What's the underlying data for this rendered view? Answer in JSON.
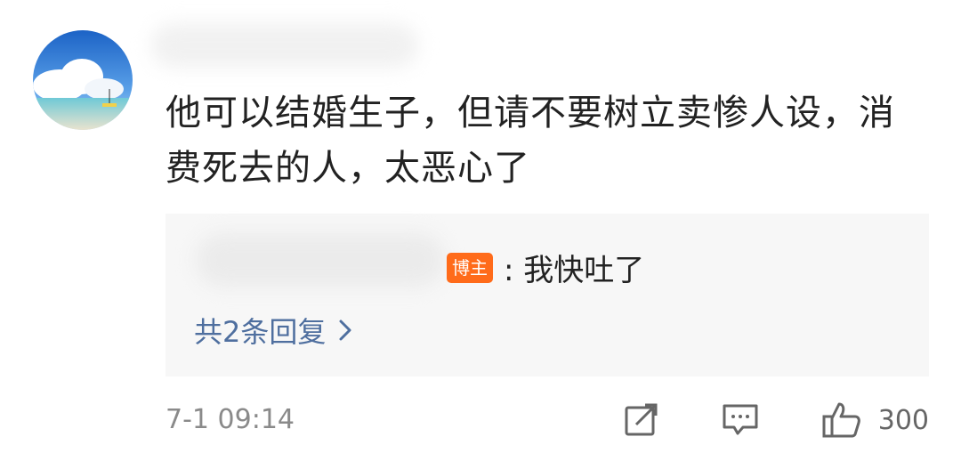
{
  "comment": {
    "text": "他可以结婚生子，但请不要树立卖惨人设，消费死去的人，太恶心了"
  },
  "reply": {
    "badge_label": "博主",
    "text": ": 我快吐了",
    "more_label": "共2条回复"
  },
  "meta": {
    "timestamp": "7-1 09:14",
    "like_count": "300"
  },
  "icons": {
    "avatar": "avatar-photo",
    "share": "share-icon",
    "reply": "comment-icon",
    "like": "thumbs-up-icon",
    "chevron": "chevron-right-icon"
  },
  "colors": {
    "badge": "#ff6b1a",
    "link": "#4f6f9f",
    "reply_bg": "#f7f7f7"
  }
}
